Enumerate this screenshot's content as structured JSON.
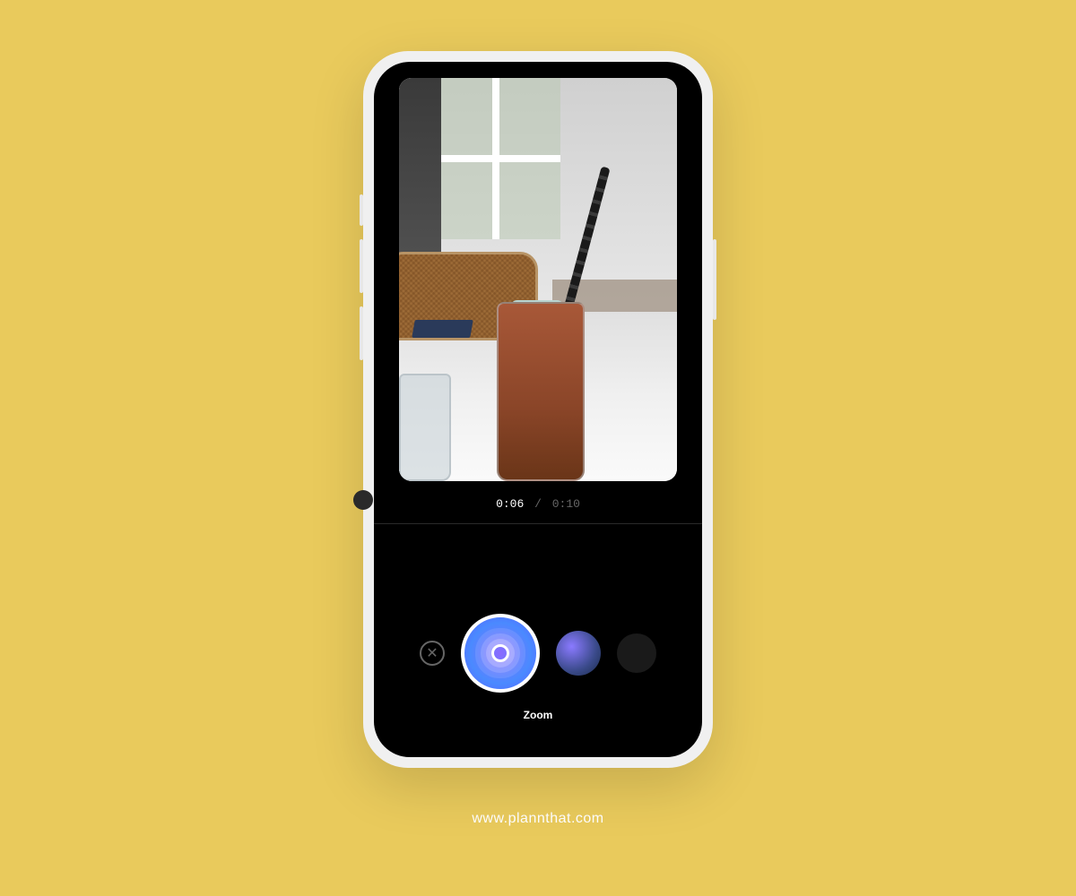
{
  "timer": {
    "current": "0:06",
    "separator": "/",
    "total": "0:10"
  },
  "effects": {
    "selected_label": "Zoom"
  },
  "icons": {
    "close": "✕"
  },
  "footer": {
    "url": "www.plannthat.com"
  },
  "colors": {
    "page_bg": "#e9ca5c",
    "phone_frame": "#f0f0f0",
    "screen_bg": "#000000",
    "effect_gradient_start": "#8a6aff",
    "effect_gradient_end": "#4a8aff"
  }
}
